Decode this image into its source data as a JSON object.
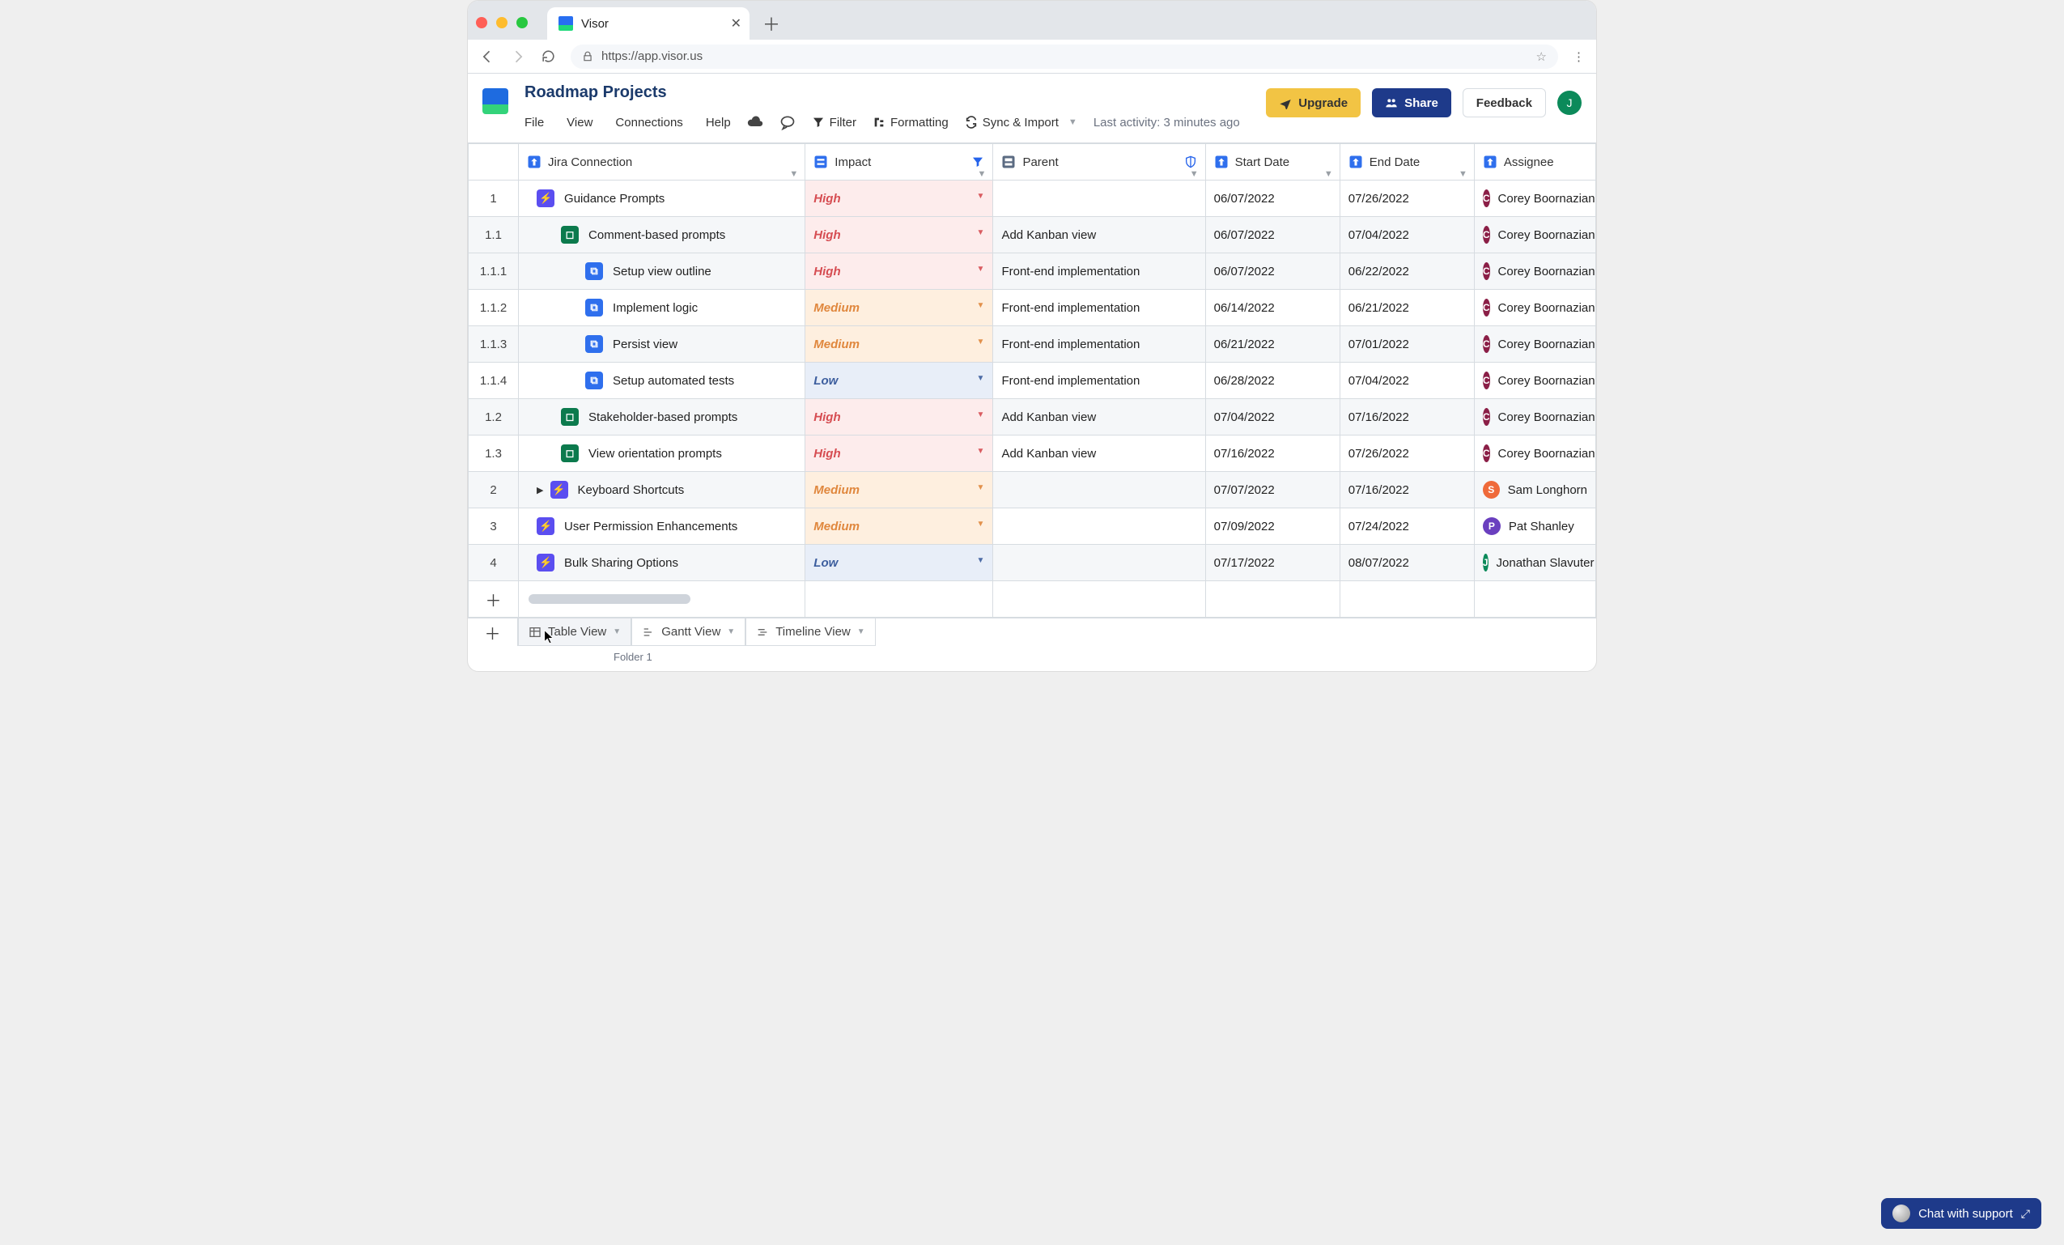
{
  "browser": {
    "tab_title": "Visor",
    "url": "https://app.visor.us"
  },
  "header": {
    "title": "Roadmap Projects",
    "menus": [
      "File",
      "View",
      "Connections",
      "Help"
    ],
    "toolbar": {
      "filter": "Filter",
      "formatting": "Formatting",
      "sync": "Sync & Import"
    },
    "activity": {
      "prefix": "Last activity: ",
      "value": "3 minutes ago"
    },
    "buttons": {
      "upgrade": "Upgrade",
      "share": "Share",
      "feedback": "Feedback"
    },
    "user_initial": "J"
  },
  "columns": {
    "jira": "Jira Connection",
    "impact": "Impact",
    "parent": "Parent",
    "start": "Start Date",
    "end": "End Date",
    "assignee": "Assignee"
  },
  "impact_levels": {
    "high": "High",
    "medium": "Medium",
    "low": "Low"
  },
  "rows": [
    {
      "num": "1",
      "indent": 0,
      "icon": "epic",
      "icon_color": "#5b4ef0",
      "title": "Guidance Prompts",
      "impact": "high",
      "parent": "",
      "start": "06/07/2022",
      "end": "07/26/2022",
      "assignee": {
        "initial": "C",
        "color": "#8b1f47",
        "name": "Corey Boornazian"
      }
    },
    {
      "num": "1.1",
      "indent": 1,
      "icon": "story",
      "icon_color": "#0c7a4d",
      "title": "Comment-based prompts",
      "impact": "high",
      "parent": "Add Kanban view",
      "start": "06/07/2022",
      "end": "07/04/2022",
      "assignee": {
        "initial": "C",
        "color": "#8b1f47",
        "name": "Corey Boornazian"
      },
      "shade": true
    },
    {
      "num": "1.1.1",
      "indent": 2,
      "icon": "subtask",
      "icon_color": "#2f6fed",
      "title": "Setup view outline",
      "impact": "high",
      "parent": "Front-end implementation",
      "start": "06/07/2022",
      "end": "06/22/2022",
      "assignee": {
        "initial": "C",
        "color": "#8b1f47",
        "name": "Corey Boornazian"
      },
      "shade": true
    },
    {
      "num": "1.1.2",
      "indent": 2,
      "icon": "subtask",
      "icon_color": "#2f6fed",
      "title": "Implement logic",
      "impact": "medium",
      "parent": "Front-end implementation",
      "start": "06/14/2022",
      "end": "06/21/2022",
      "assignee": {
        "initial": "C",
        "color": "#8b1f47",
        "name": "Corey Boornazian"
      }
    },
    {
      "num": "1.1.3",
      "indent": 2,
      "icon": "subtask",
      "icon_color": "#2f6fed",
      "title": "Persist view",
      "impact": "medium",
      "parent": "Front-end implementation",
      "start": "06/21/2022",
      "end": "07/01/2022",
      "assignee": {
        "initial": "C",
        "color": "#8b1f47",
        "name": "Corey Boornazian"
      },
      "shade": true
    },
    {
      "num": "1.1.4",
      "indent": 2,
      "icon": "subtask",
      "icon_color": "#2f6fed",
      "title": "Setup automated tests",
      "impact": "low",
      "parent": "Front-end implementation",
      "start": "06/28/2022",
      "end": "07/04/2022",
      "assignee": {
        "initial": "C",
        "color": "#8b1f47",
        "name": "Corey Boornazian"
      }
    },
    {
      "num": "1.2",
      "indent": 1,
      "icon": "story",
      "icon_color": "#0c7a4d",
      "title": "Stakeholder-based prompts",
      "impact": "high",
      "parent": "Add Kanban view",
      "start": "07/04/2022",
      "end": "07/16/2022",
      "assignee": {
        "initial": "C",
        "color": "#8b1f47",
        "name": "Corey Boornazian"
      },
      "shade": true
    },
    {
      "num": "1.3",
      "indent": 1,
      "icon": "story",
      "icon_color": "#0c7a4d",
      "title": "View orientation  prompts",
      "impact": "high",
      "parent": "Add Kanban view",
      "start": "07/16/2022",
      "end": "07/26/2022",
      "assignee": {
        "initial": "C",
        "color": "#8b1f47",
        "name": "Corey Boornazian"
      }
    },
    {
      "num": "2",
      "indent": 0,
      "icon": "epic",
      "icon_color": "#5b4ef0",
      "title": "Keyboard Shortcuts",
      "impact": "medium",
      "parent": "",
      "start": "07/07/2022",
      "end": "07/16/2022",
      "assignee": {
        "initial": "S",
        "color": "#ef6a3a",
        "name": "Sam Longhorn"
      },
      "caret": true,
      "shade": true
    },
    {
      "num": "3",
      "indent": 0,
      "icon": "epic",
      "icon_color": "#5b4ef0",
      "title": "User Permission Enhancements",
      "impact": "medium",
      "parent": "",
      "start": "07/09/2022",
      "end": "07/24/2022",
      "assignee": {
        "initial": "P",
        "color": "#6a3fbf",
        "name": "Pat Shanley"
      }
    },
    {
      "num": "4",
      "indent": 0,
      "icon": "epic",
      "icon_color": "#5b4ef0",
      "title": "Bulk Sharing Options",
      "impact": "low",
      "parent": "",
      "start": "07/17/2022",
      "end": "08/07/2022",
      "assignee": {
        "initial": "J",
        "color": "#0c8a5a",
        "name": "Jonathan Slavuter"
      },
      "shade": true
    }
  ],
  "bottom": {
    "views": [
      "Table View",
      "Gantt View",
      "Timeline View"
    ],
    "folder": "Folder 1"
  },
  "chat": {
    "label": "Chat with support"
  }
}
